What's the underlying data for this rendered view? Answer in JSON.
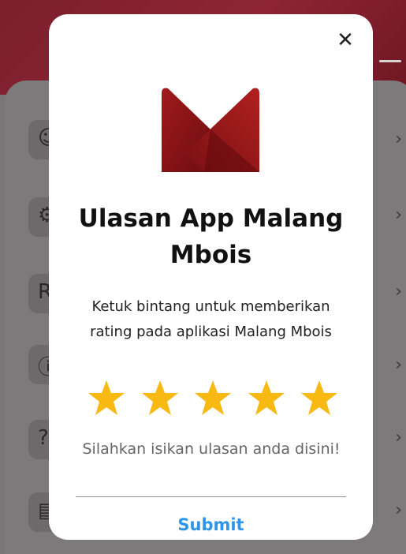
{
  "dialog": {
    "title": "Ulasan App Malang Mbois",
    "description": "Ketuk bintang untuk memberikan rating pada aplikasi Malang Mbois",
    "review_placeholder": "Silahkan isikan ulasan anda disini!",
    "submit_label": "Submit",
    "close_icon": "close-icon",
    "rating_selected": 5,
    "rating_max": 5
  },
  "colors": {
    "star": "#f7b912",
    "submit": "#2f95e8",
    "logo": "#8c1416"
  },
  "background": {
    "chevron": "›",
    "menu_icons": [
      "user-circle-icon",
      "gear-icon",
      "r-letter-icon",
      "shield-info-icon",
      "question-icon",
      "feedback-icon"
    ]
  }
}
